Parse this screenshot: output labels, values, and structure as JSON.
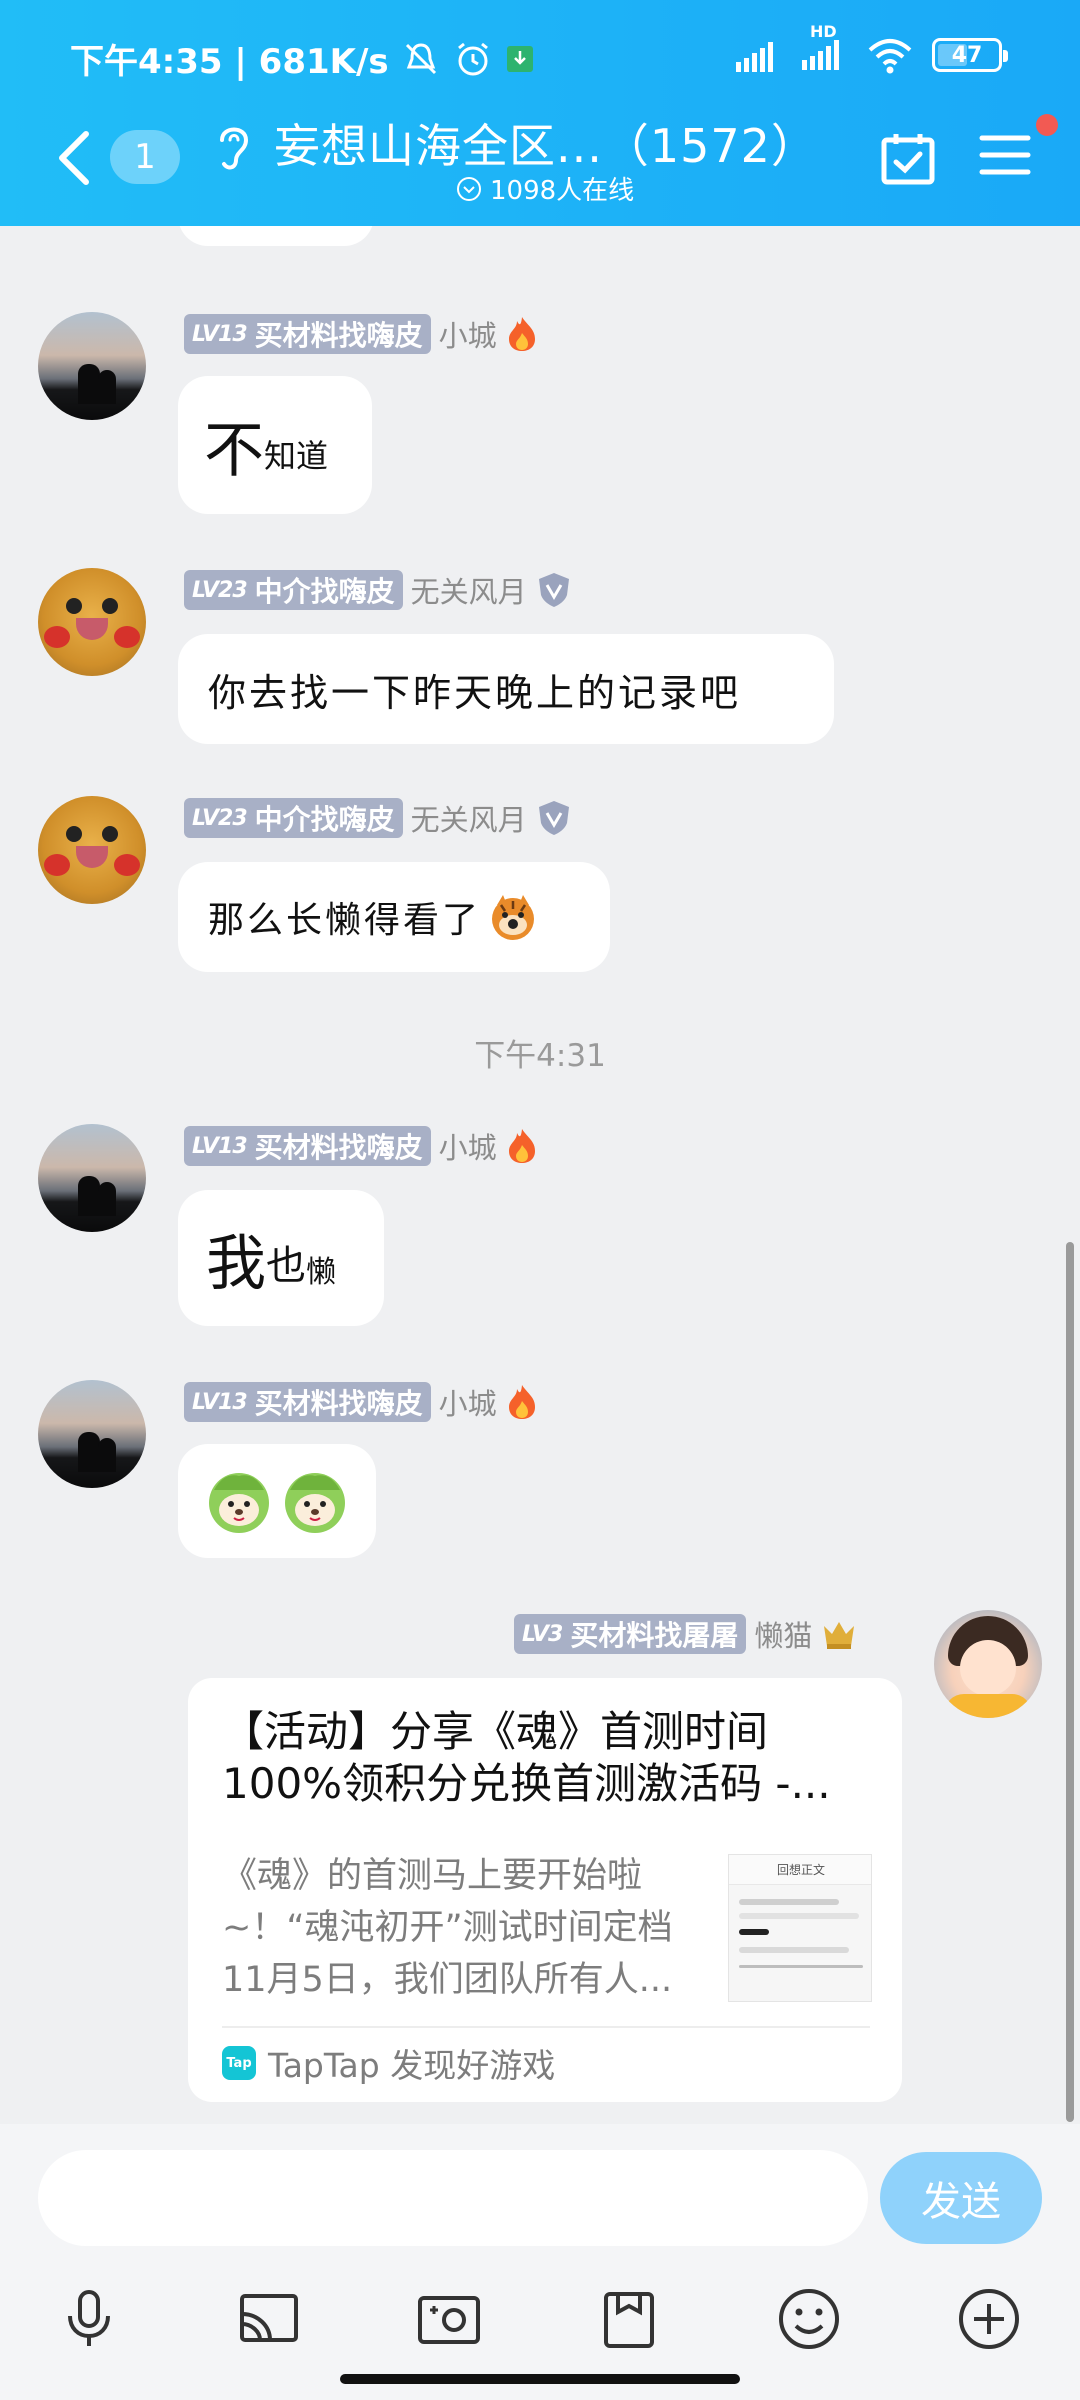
{
  "status_bar": {
    "time_speed": "下午4:35 | 681K/s",
    "network_label": "HD",
    "battery": "47",
    "battery_level_percent": 47
  },
  "header": {
    "unread_count": "1",
    "title": "妄想山海全区...（1572）",
    "online": "1098人在线"
  },
  "messages": [
    {
      "badge_level": "LV13",
      "badge_title": "买材料找嗨皮",
      "nickname": "小城",
      "text_big": "不",
      "text_small": "知道"
    },
    {
      "badge_level": "LV23",
      "badge_title": "中介找嗨皮",
      "nickname": "无关风月",
      "text": "你去找一下昨天晚上的记录吧"
    },
    {
      "badge_level": "LV23",
      "badge_title": "中介找嗨皮",
      "nickname": "无关风月",
      "text": "那么长懒得看了"
    },
    {
      "badge_level": "LV13",
      "badge_title": "买材料找嗨皮",
      "nickname": "小城",
      "text_big": "我",
      "text_mid": "也",
      "text_small": "懒"
    },
    {
      "badge_level": "LV13",
      "badge_title": "买材料找嗨皮",
      "nickname": "小城",
      "sticker": "two-cabbage-dog-stickers"
    },
    {
      "badge_level": "LV3",
      "badge_title": "买材料找屠屠",
      "nickname": "懒猫"
    }
  ],
  "time_separator": "下午4:31",
  "share_card": {
    "title": "【活动】分享《魂》首测时间100%领积分兑换首测激活码 -...",
    "description": "《魂》的首测马上要开始啦~！“魂沌初开”测试时间定档11月5日，我们团队所有人...",
    "thumbnail_header": "回想正文",
    "source": "TapTap 发现好游戏",
    "source_logo_text": "Tap"
  },
  "composer": {
    "input_value": "",
    "send_label": "发送"
  },
  "toolbar_icons": [
    "microphone-icon",
    "screen-cast-icon",
    "photo-icon",
    "clipboard-icon",
    "emoji-icon",
    "plus-circle-icon"
  ],
  "colors": {
    "header_start": "#21bdf7",
    "header_end": "#1aa9f7",
    "badge": "#a8b0c6",
    "send_button": "#8fd2fb",
    "chat_background": "#eff0f2"
  }
}
